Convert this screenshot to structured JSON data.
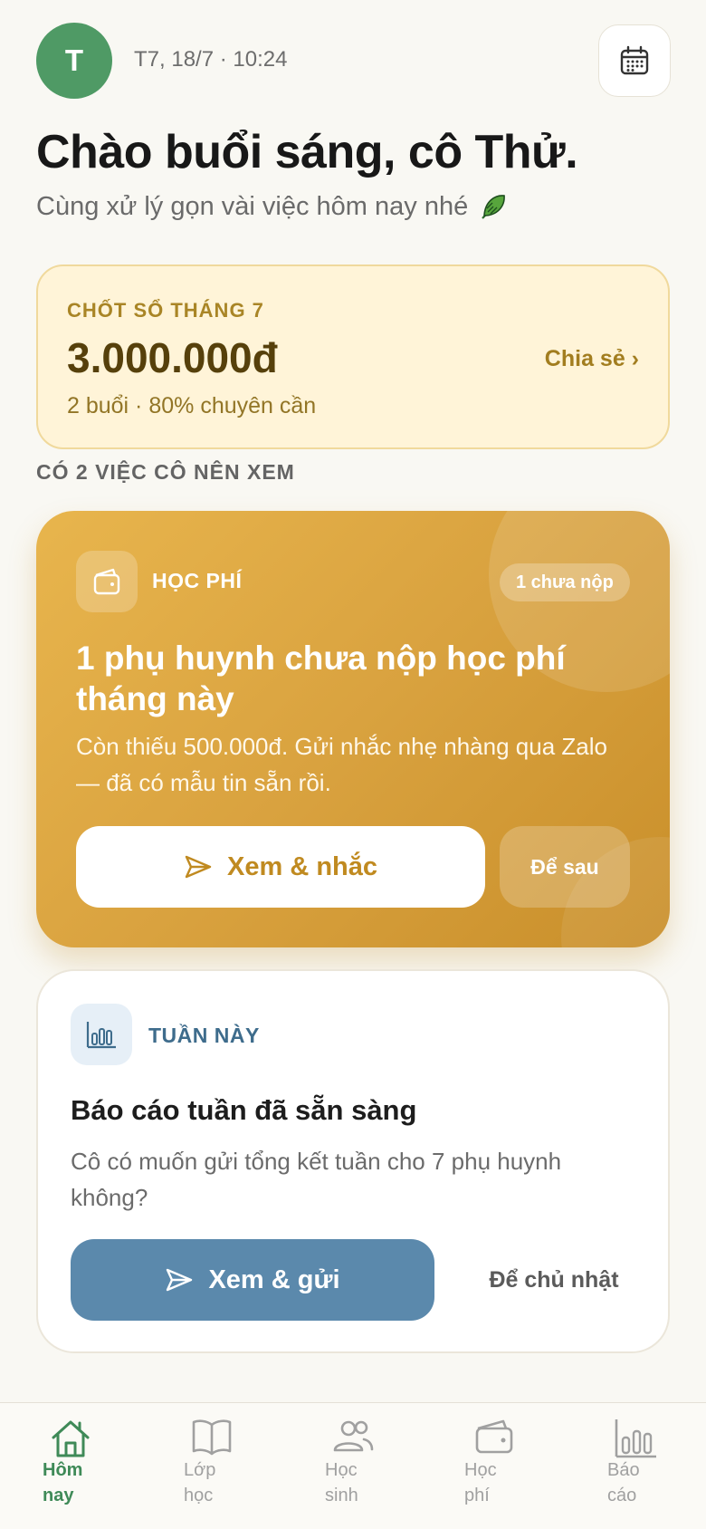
{
  "header": {
    "avatar_letter": "T",
    "date_time": "T7, 18/7 · 10:24",
    "calendar_icon": "calendar-icon"
  },
  "greeting": {
    "title": "Chào buổi sáng, cô Thử.",
    "subtitle": "Cùng xử lý gọn vài việc hôm nay nhé"
  },
  "summary": {
    "label": "CHỐT SỔ THÁNG 7",
    "amount": "3.000.000đ",
    "meta": "2 buổi · 80% chuyên cần",
    "share": "Chia sẻ ›"
  },
  "section_title": "CÓ 2 VIỆC CÔ NÊN XEM",
  "fee_card": {
    "kicker": "HỌC PHÍ",
    "badge": "1 chưa nộp",
    "title": "1 phụ huynh chưa nộp học phí tháng này",
    "description": "Còn thiếu 500.000đ. Gửi nhắc nhẹ nhàng qua Zalo — đã có mẫu tin sẵn rồi.",
    "primary_label": "Xem & nhắc",
    "secondary_label": "Để sau"
  },
  "weekly_card": {
    "kicker": "TUẦN NÀY",
    "title": "Báo cáo tuần đã sẵn sàng",
    "description": "Cô có muốn gửi tổng kết tuần cho 7 phụ huynh không?",
    "primary_label": "Xem & gửi",
    "secondary_label": "Để chủ nhật"
  },
  "tabs": [
    {
      "label_line1": "Hôm",
      "label_line2": "nay",
      "icon": "home-icon",
      "active": true
    },
    {
      "label_line1": "Lớp",
      "label_line2": "học",
      "icon": "book-icon",
      "active": false
    },
    {
      "label_line1": "Học",
      "label_line2": "sinh",
      "icon": "students-icon",
      "active": false
    },
    {
      "label_line1": "Học",
      "label_line2": "phí",
      "icon": "wallet-icon",
      "active": false
    },
    {
      "label_line1": "Báo",
      "label_line2": "cáo",
      "icon": "chart-icon",
      "active": false
    }
  ],
  "colors": {
    "brand_green": "#4f9a65",
    "fee_gold": "#d9a23f",
    "report_blue": "#5b89ac",
    "summary_bg": "#fff4d8"
  }
}
